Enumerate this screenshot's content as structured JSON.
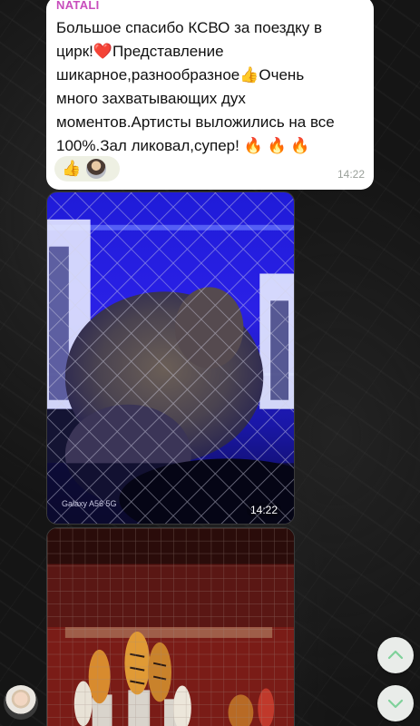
{
  "message": {
    "sender": "NATALI",
    "text": "Большое спасибо КСВО за поездку в\nцирк!❤️Представление\nшикарное,разнообразное👍Очень\nмного захватывающих дух\nмоментов.Артисты выложились на все\n100%.Зал ликовал,супер! 🔥 🔥 🔥",
    "time": "14:22",
    "reaction_emoji": "👍"
  },
  "photo1": {
    "watermark": "Galaxy A56 5G",
    "time": "14:22"
  },
  "icons": {
    "scroll_up": "chevron-up-icon",
    "scroll_down": "chevron-down-icon"
  },
  "colors": {
    "sender": "#c84dbc",
    "bubble": "#ffffff",
    "scroll_icon": "#7fd19a"
  }
}
